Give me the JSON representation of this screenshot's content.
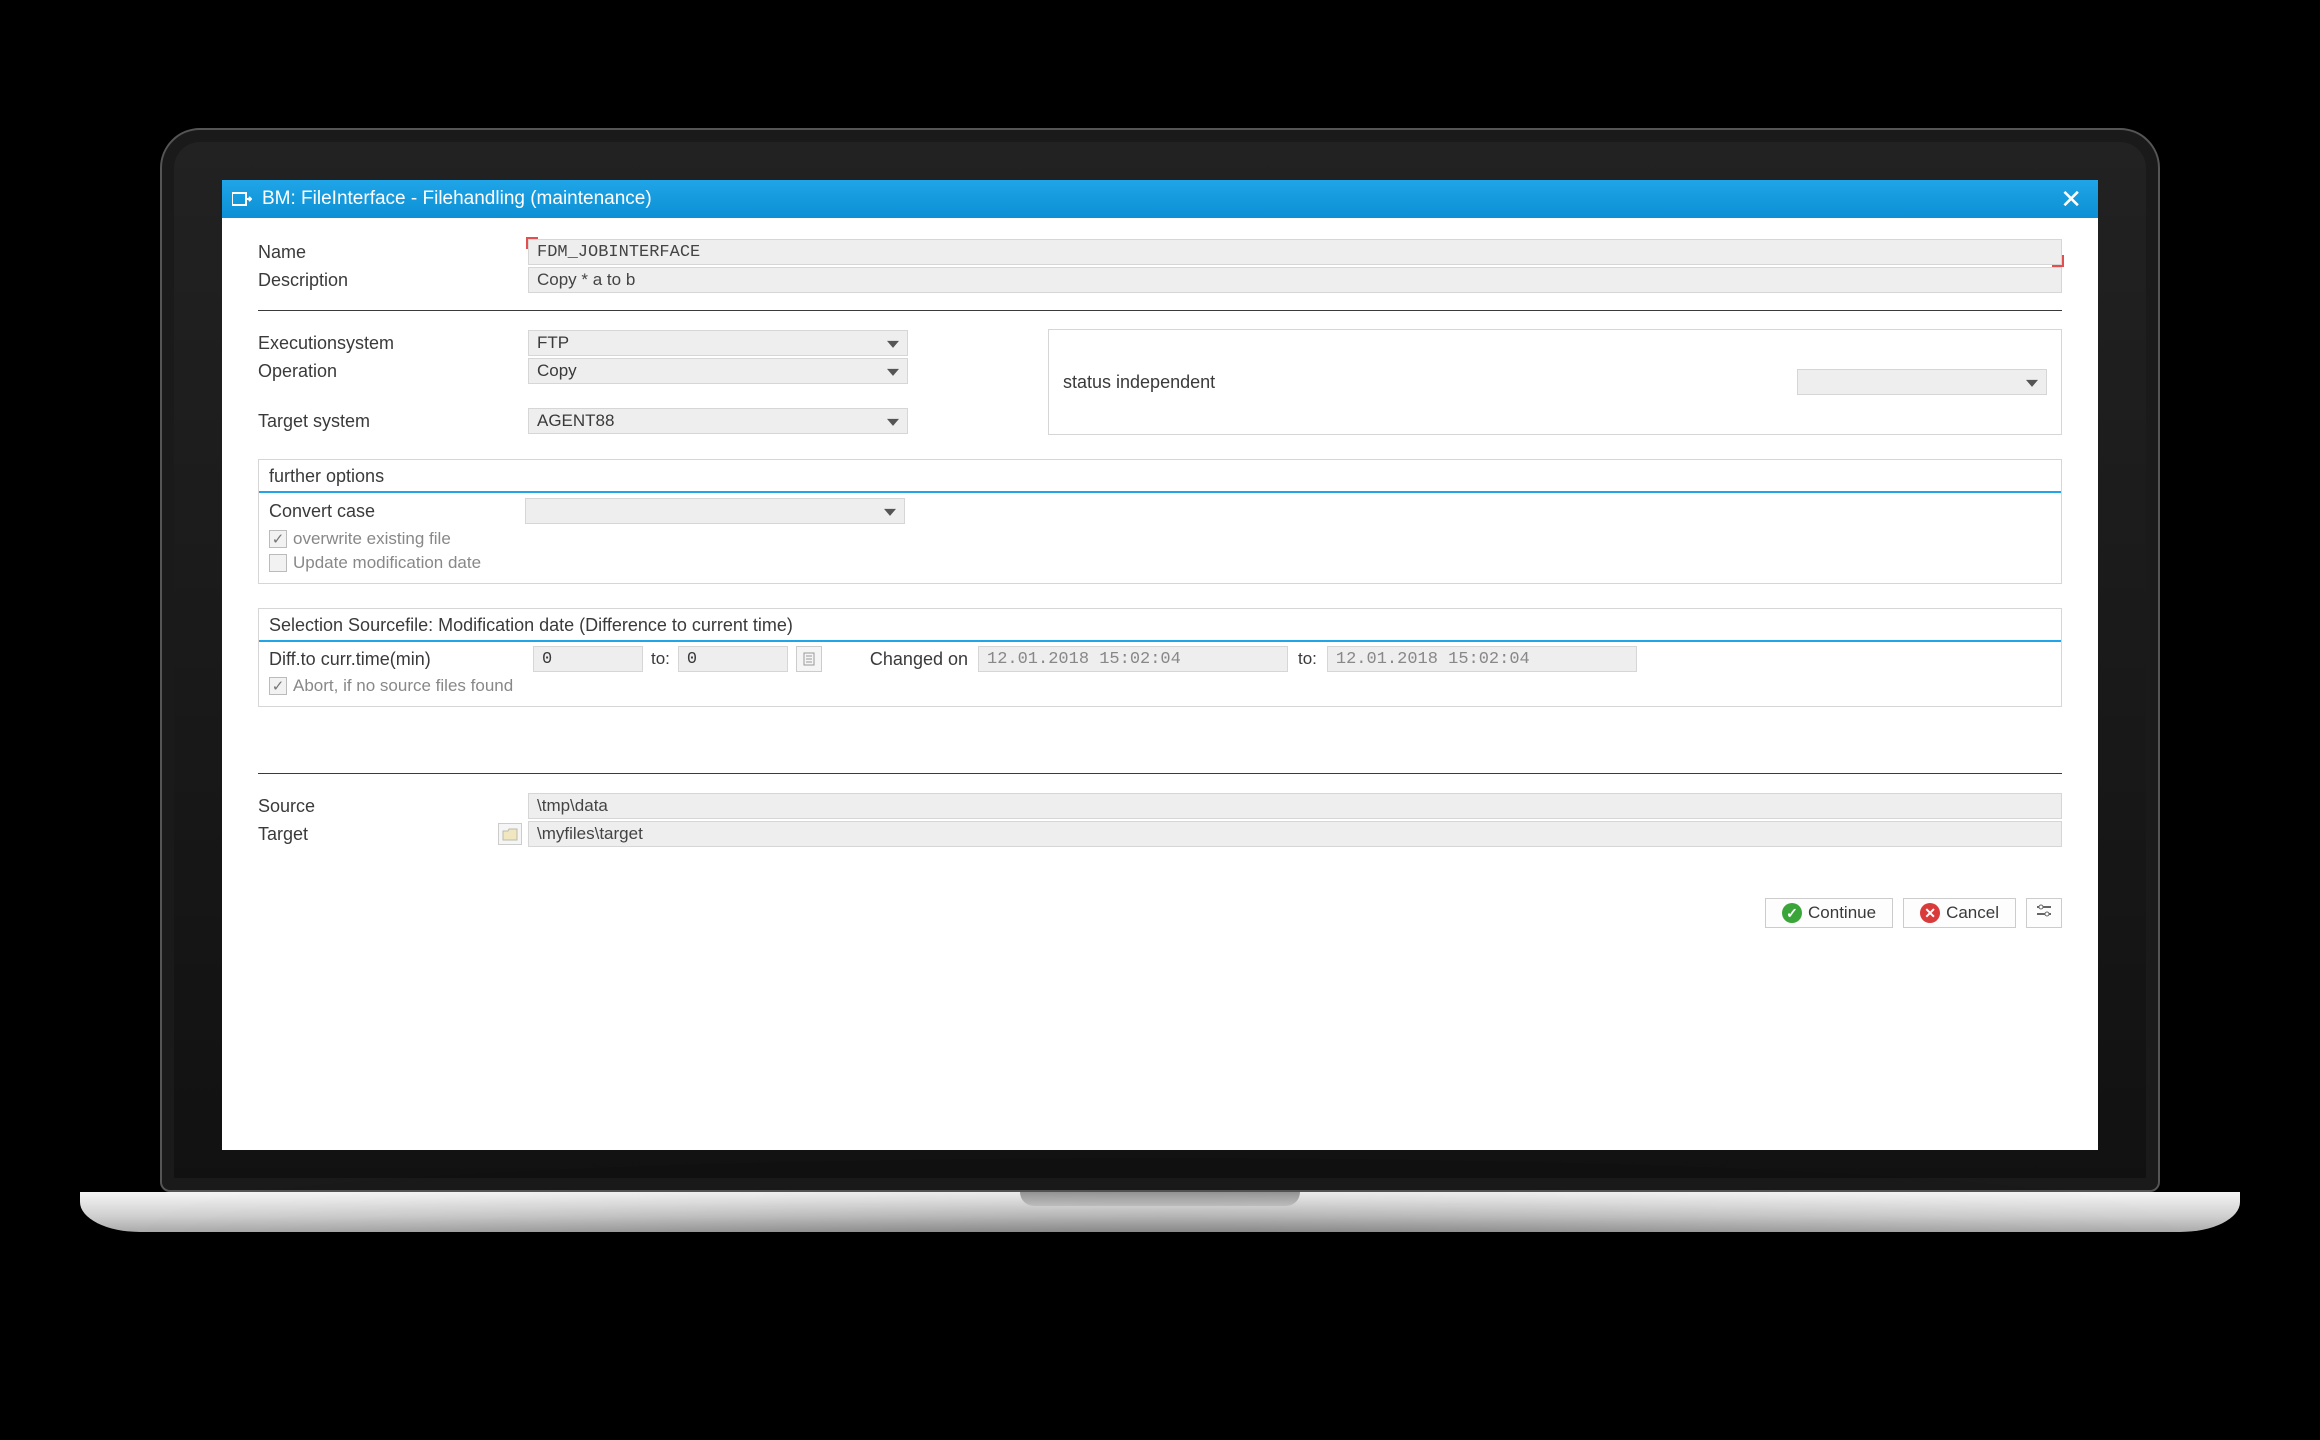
{
  "window": {
    "title": "BM: FileInterface - Filehandling (maintenance)"
  },
  "header": {
    "name_label": "Name",
    "name_value": "FDM_JOBINTERFACE",
    "desc_label": "Description",
    "desc_value": "Copy * a to b"
  },
  "exec": {
    "system_label": "Executionsystem",
    "system_value": "FTP",
    "operation_label": "Operation",
    "operation_value": "Copy",
    "target_label": "Target system",
    "target_value": "AGENT88",
    "status_label": "status independent",
    "status_value": ""
  },
  "further": {
    "title": "further options",
    "convert_label": "Convert case",
    "convert_value": "",
    "overwrite_label": "overwrite existing file",
    "overwrite_checked": true,
    "update_label": "Update modification date",
    "update_checked": false
  },
  "selection": {
    "title": "Selection Sourcefile: Modification date (Difference to current time)",
    "diff_label": "Diff.to curr.time(min)",
    "diff_from": "0",
    "to_label": "to:",
    "diff_to": "0",
    "changed_label": "Changed on",
    "changed_from": "12.01.2018 15:02:04",
    "changed_to": "12.01.2018 15:02:04",
    "abort_label": "Abort, if no source files found",
    "abort_checked": true
  },
  "paths": {
    "source_label": "Source",
    "source_value": "\\tmp\\data",
    "target_label": "Target",
    "target_value": "\\myfiles\\target"
  },
  "buttons": {
    "continue": "Continue",
    "cancel": "Cancel"
  }
}
